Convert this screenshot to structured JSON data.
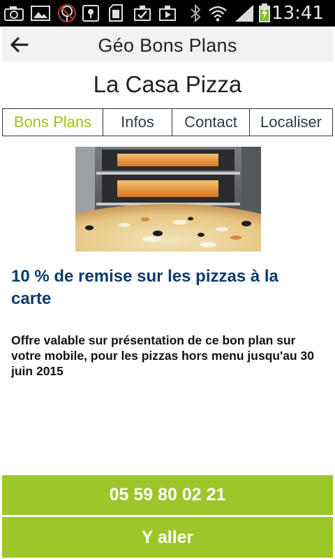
{
  "status_bar": {
    "time": "13:41",
    "icons": [
      "screenshot-icon",
      "gallery-icon",
      "no-location-icon",
      "maps-icon",
      "sd-card-icon",
      "download-done-icon",
      "play-store-icon",
      "bluetooth-icon",
      "wifi-icon",
      "signal-icon",
      "battery-charging-icon"
    ]
  },
  "app_bar": {
    "title": "Géo Bons Plans",
    "back_icon": "arrow-left-icon"
  },
  "shop": {
    "name": "La Casa Pizza"
  },
  "tabs": [
    {
      "label": "Bons Plans",
      "active": true
    },
    {
      "label": "Infos",
      "active": false
    },
    {
      "label": "Contact",
      "active": false
    },
    {
      "label": "Localiser",
      "active": false
    }
  ],
  "offer": {
    "image": "pizza-oven-image",
    "title": "10 % de remise sur les pizzas à la carte",
    "description": "Offre valable sur présentation de ce bon plan sur votre mobile, pour les pizzas hors menu jusqu'au 30 juin 2015"
  },
  "actions": {
    "phone": "05 59 80 02 21",
    "go": "Y aller"
  },
  "colors": {
    "accent": "#9cc629",
    "active_tab": "#9cc21b",
    "offer_title": "#0d3a6e"
  }
}
